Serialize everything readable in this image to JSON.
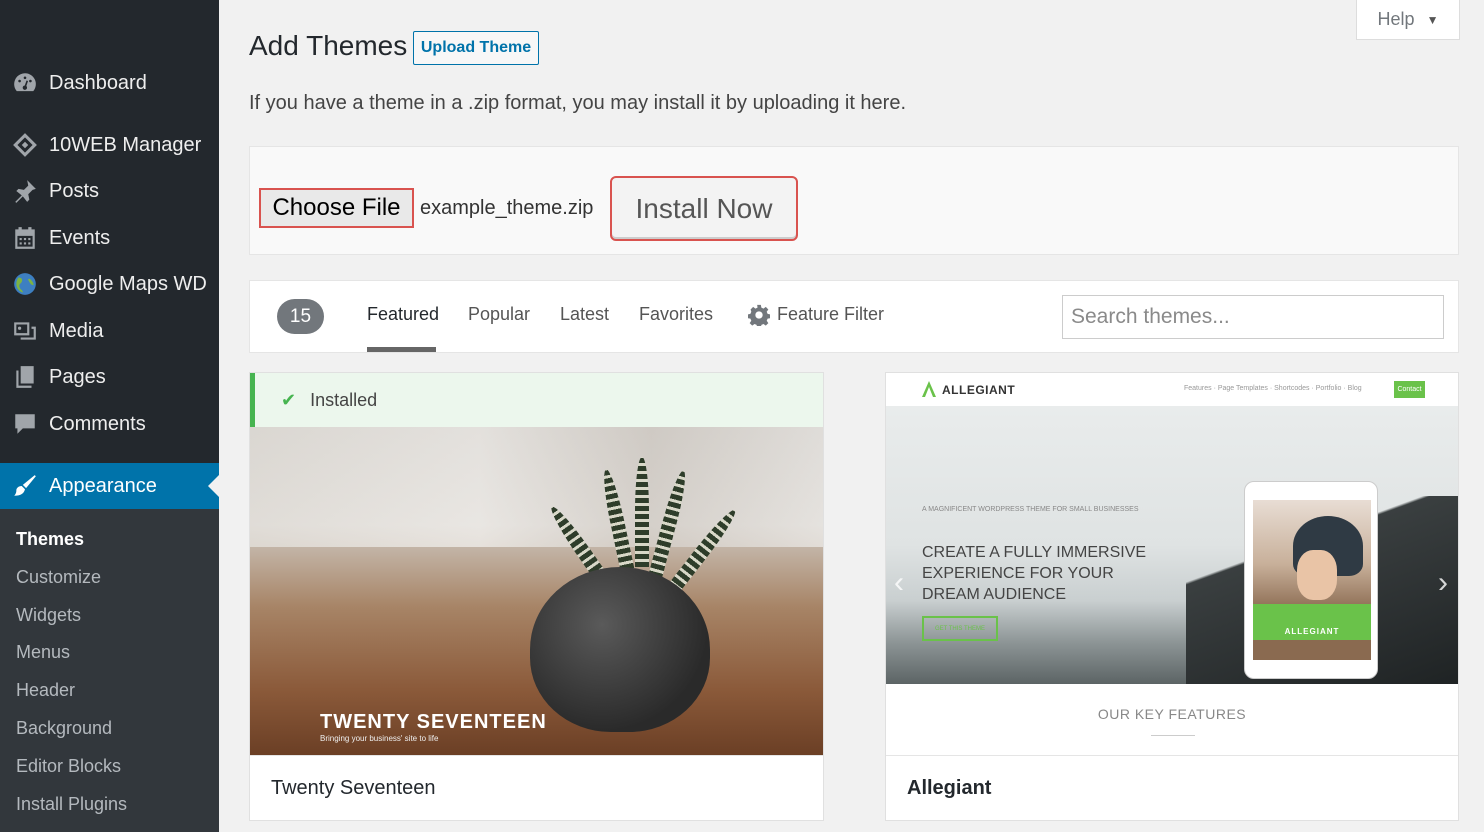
{
  "sidebar": {
    "items": [
      {
        "label": "Dashboard",
        "icon": "dashboard-icon"
      },
      {
        "label": "10WEB Manager",
        "icon": "diamond-icon"
      },
      {
        "label": "Posts",
        "icon": "pin-icon"
      },
      {
        "label": "Events",
        "icon": "calendar-icon"
      },
      {
        "label": "Google Maps WD",
        "icon": "globe-icon"
      },
      {
        "label": "Media",
        "icon": "media-icon"
      },
      {
        "label": "Pages",
        "icon": "pages-icon"
      },
      {
        "label": "Comments",
        "icon": "comment-icon"
      },
      {
        "label": "Appearance",
        "icon": "brush-icon"
      }
    ],
    "submenu": [
      "Themes",
      "Customize",
      "Widgets",
      "Menus",
      "Header",
      "Background",
      "Editor Blocks",
      "Install Plugins"
    ]
  },
  "header": {
    "title": "Add Themes",
    "upload_label": "Upload Theme",
    "help_label": "Help",
    "intro": "If you have a theme in a .zip format, you may install it by uploading it here."
  },
  "upload": {
    "choose_label": "Choose File",
    "file_name": "example_theme.zip",
    "install_label": "Install Now"
  },
  "filters": {
    "count": "15",
    "tabs": [
      "Featured",
      "Popular",
      "Latest",
      "Favorites"
    ],
    "feature_filter": "Feature Filter",
    "search_placeholder": "Search themes..."
  },
  "themes": [
    {
      "name": "Twenty Seventeen",
      "status": "Installed",
      "screenshot_title": "TWENTY SEVENTEEN",
      "screenshot_tagline": "Bringing your business' site to life"
    },
    {
      "name": "Allegiant",
      "screenshot_logo": "ALLEGIANT",
      "screenshot_nav": "Features ·  Page Templates ·  Shortcodes ·  Portfolio ·  Blog",
      "screenshot_contact": "Contact",
      "screenshot_kicker": "A MAGNIFICENT WORDPRESS THEME FOR SMALL BUSINESSES",
      "screenshot_headline": "CREATE A FULLY IMMERSIVE EXPERIENCE FOR YOUR DREAM AUDIENCE",
      "screenshot_cta": "GET THIS THEME",
      "screenshot_tablet_label": "ALLEGIANT",
      "screenshot_features": "OUR KEY FEATURES"
    }
  ],
  "colors": {
    "sidebar_bg": "#23282d",
    "active_blue": "#0073aa",
    "highlight_red": "#d9534f",
    "installed_green": "#46b450"
  }
}
